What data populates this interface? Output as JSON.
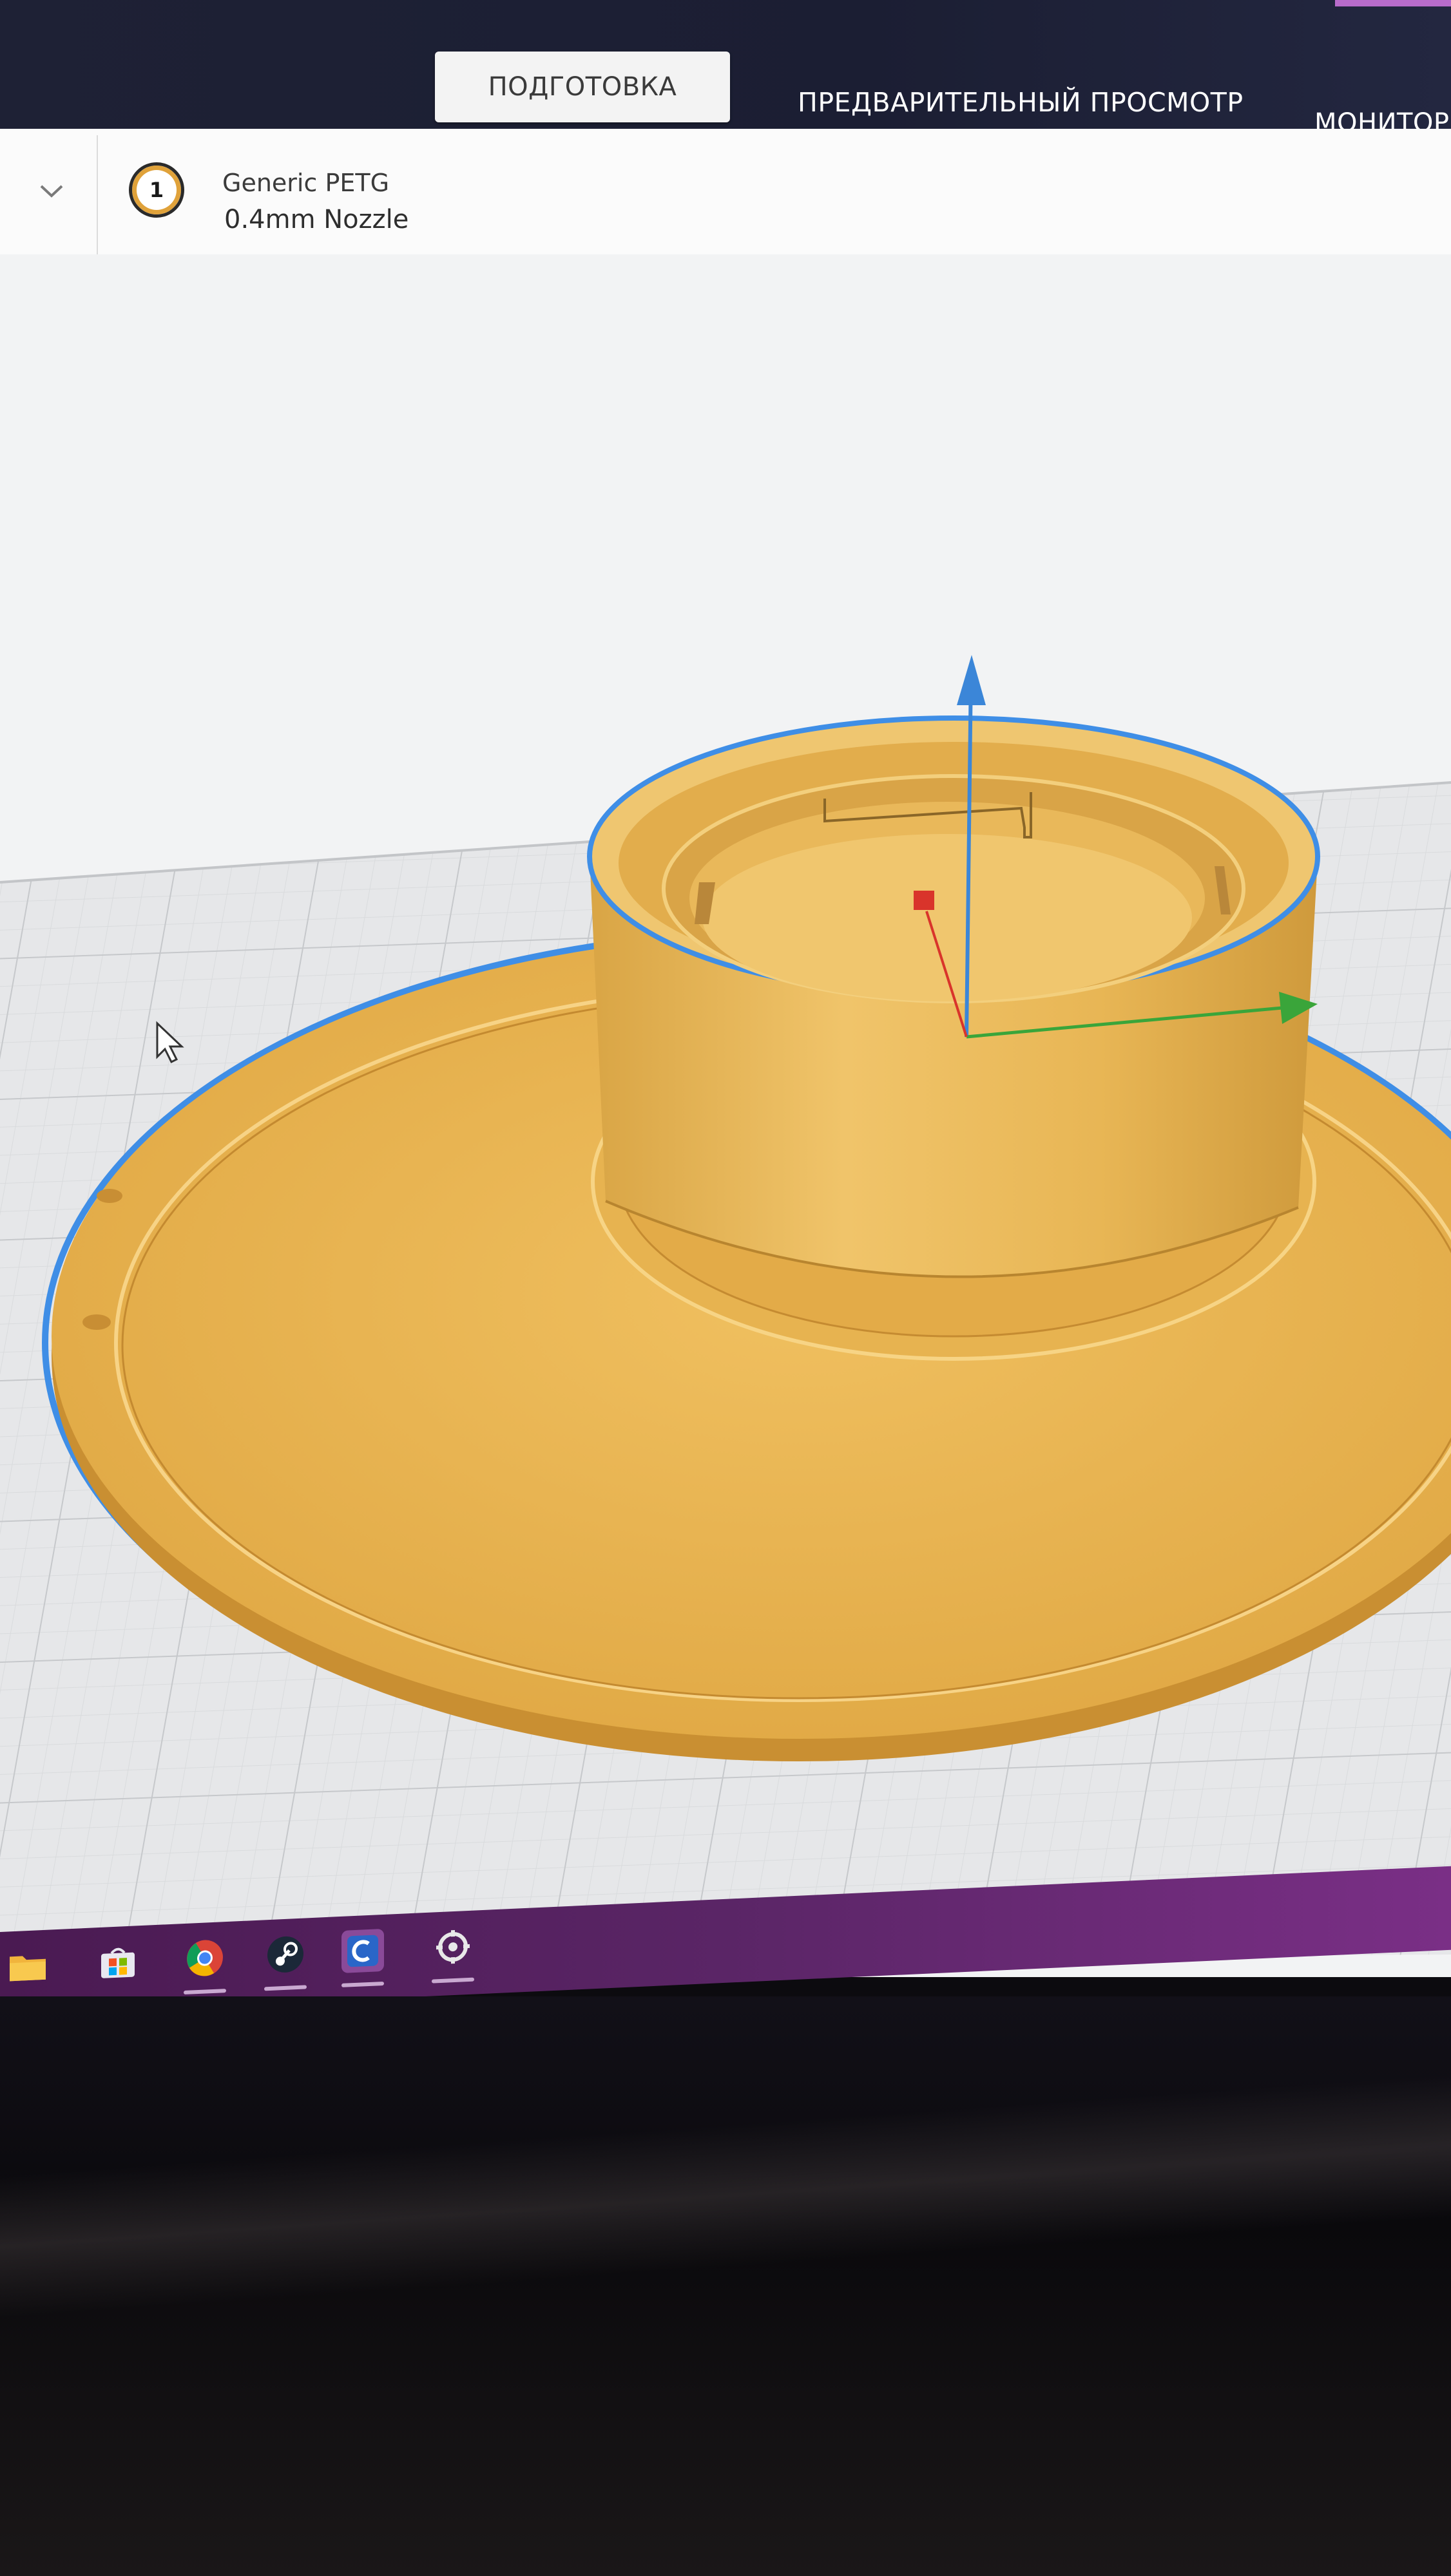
{
  "header": {
    "tabs": [
      {
        "label": "ПОДГОТОВКА",
        "active": true
      },
      {
        "label": "ПРЕДВАРИТЕЛЬНЫЙ ПРОСМОТР",
        "active": false
      },
      {
        "label": "МОНИТОР",
        "active": false
      }
    ]
  },
  "material_strip": {
    "extruder_number": "1",
    "material": "Generic PETG",
    "nozzle": "0.4mm Nozzle"
  },
  "viewport": {
    "model_color": "#e9b44c",
    "selection_outline_color": "#3f8ee6",
    "axis_colors": {
      "x": "#d9342b",
      "y": "#3aa53a",
      "z": "#3b86d8"
    }
  },
  "taskbar": {
    "icons": [
      "folder-icon",
      "store-icon",
      "chrome-icon",
      "steam-icon",
      "cura-icon",
      "steelseries-icon"
    ]
  }
}
